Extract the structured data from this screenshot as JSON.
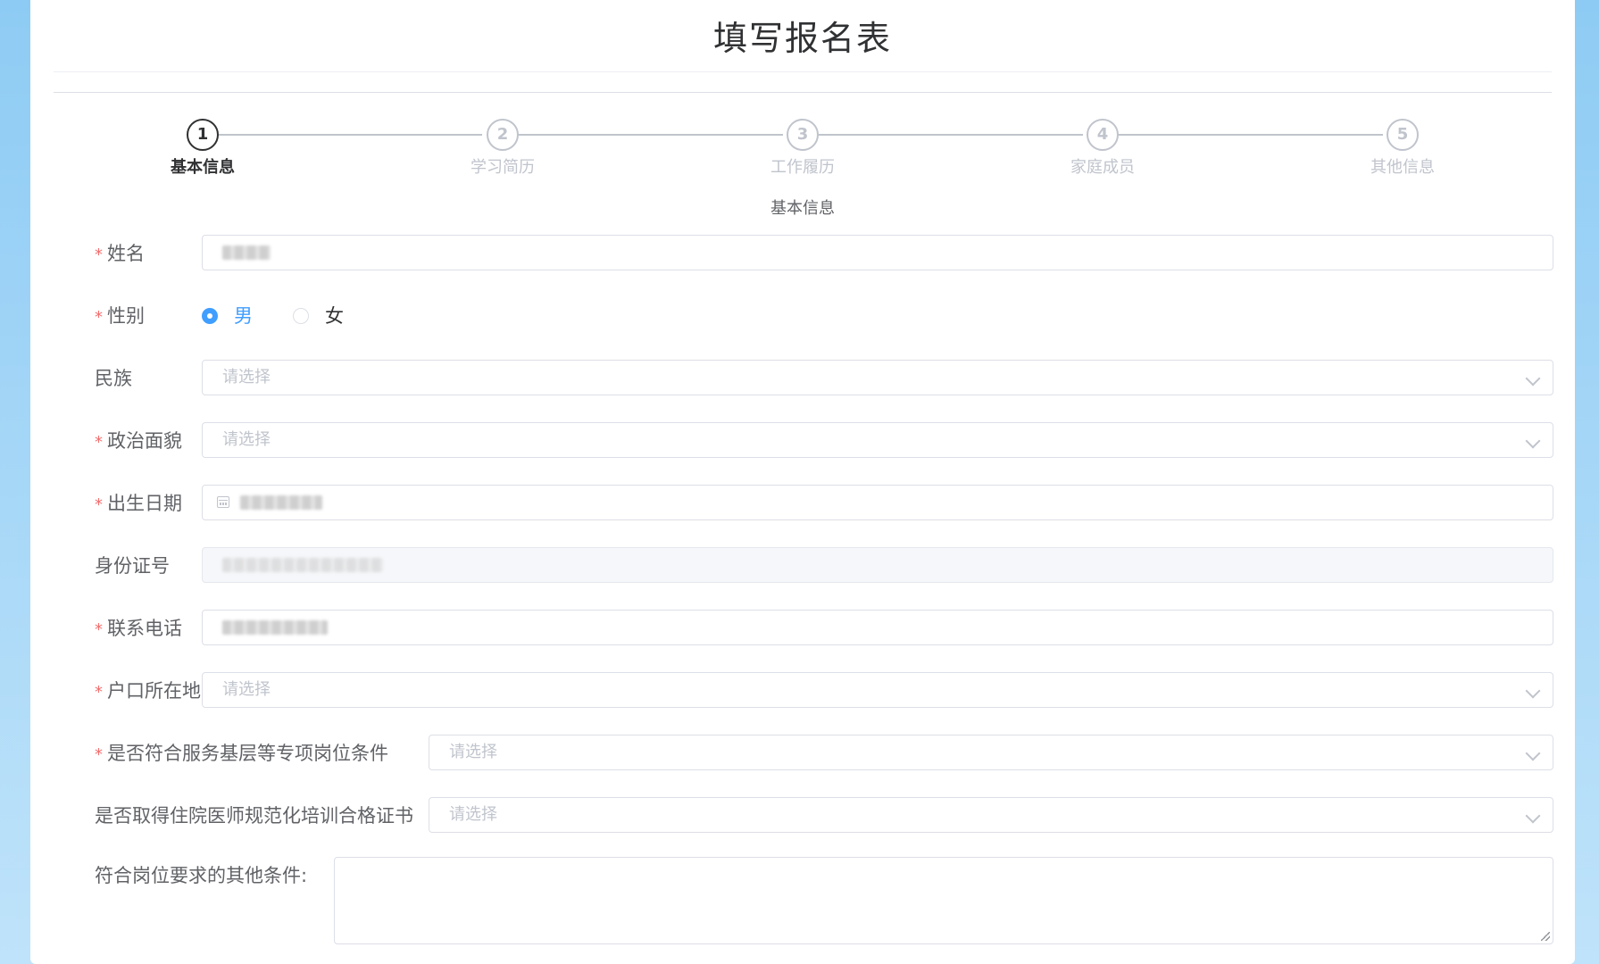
{
  "page": {
    "title": "填写报名表",
    "section_title": "基本信息"
  },
  "steps": [
    {
      "num": "1",
      "label": "基本信息",
      "active": true
    },
    {
      "num": "2",
      "label": "学习简历",
      "active": false
    },
    {
      "num": "3",
      "label": "工作履历",
      "active": false
    },
    {
      "num": "4",
      "label": "家庭成员",
      "active": false
    },
    {
      "num": "5",
      "label": "其他信息",
      "active": false
    }
  ],
  "form": {
    "name": {
      "label": "姓名",
      "required": true
    },
    "gender": {
      "label": "性别",
      "required": true,
      "options": [
        "男",
        "女"
      ],
      "selected": "男"
    },
    "ethnicity": {
      "label": "民族",
      "required": false,
      "placeholder": "请选择"
    },
    "political_status": {
      "label": "政治面貌",
      "required": true,
      "placeholder": "请选择"
    },
    "birth_date": {
      "label": "出生日期",
      "required": true
    },
    "id_number": {
      "label": "身份证号",
      "required": false
    },
    "phone": {
      "label": "联系电话",
      "required": true
    },
    "household": {
      "label": "户口所在地",
      "required": true,
      "placeholder": "请选择"
    },
    "special_post": {
      "label": "是否符合服务基层等专项岗位条件",
      "required": true,
      "placeholder": "请选择"
    },
    "residency_cert": {
      "label": "是否取得住院医师规范化培训合格证书",
      "required": false,
      "placeholder": "请选择"
    },
    "other_conditions": {
      "label": "符合岗位要求的其他条件:",
      "required": false
    }
  },
  "colors": {
    "primary": "#409eff",
    "required": "#f56c6c",
    "border": "#dcdfe6",
    "placeholder": "#c0c4cc"
  }
}
